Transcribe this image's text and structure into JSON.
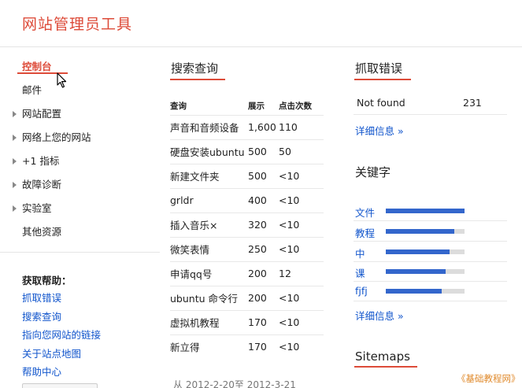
{
  "header": {
    "title": "网站管理员工具"
  },
  "nav": {
    "items": [
      {
        "label": "控制台",
        "active": true,
        "expandable": false
      },
      {
        "label": "邮件",
        "active": false,
        "expandable": false
      },
      {
        "label": "网站配置",
        "active": false,
        "expandable": true
      },
      {
        "label": "网络上您的网站",
        "active": false,
        "expandable": true
      },
      {
        "label": "+1 指标",
        "active": false,
        "expandable": true
      },
      {
        "label": "故障诊断",
        "active": false,
        "expandable": true
      },
      {
        "label": "实验室",
        "active": false,
        "expandable": true
      },
      {
        "label": "其他资源",
        "active": false,
        "expandable": false
      }
    ]
  },
  "help": {
    "title": "获取帮助：",
    "links": [
      "抓取错误",
      "搜索查询",
      "指向您网站的链接",
      "关于站点地图",
      "帮助中心"
    ]
  },
  "queries": {
    "title": "搜索查询",
    "columns": [
      "查询",
      "展示",
      "点击次数"
    ],
    "rows": [
      {
        "query": "声音和音频设备",
        "impressions": "1,600",
        "clicks": "110"
      },
      {
        "query": "硬盘安装ubuntu",
        "impressions": "500",
        "clicks": "50"
      },
      {
        "query": "新建文件夹",
        "impressions": "500",
        "clicks": "<10"
      },
      {
        "query": "grldr",
        "impressions": "400",
        "clicks": "<10"
      },
      {
        "query": "插入音乐×",
        "impressions": "320",
        "clicks": "<10"
      },
      {
        "query": "微笑表情",
        "impressions": "250",
        "clicks": "<10"
      },
      {
        "query": "申请qq号",
        "impressions": "200",
        "clicks": "12"
      },
      {
        "query": "ubuntu 命令行",
        "impressions": "200",
        "clicks": "<10"
      },
      {
        "query": "虚拟机教程",
        "impressions": "170",
        "clicks": "<10"
      },
      {
        "query": "新立得",
        "impressions": "170",
        "clicks": "<10"
      }
    ],
    "date_range": "从 2012-2-20至 2012-3-21"
  },
  "crawl_errors": {
    "title": "抓取错误",
    "rows": [
      {
        "label": "Not found",
        "count": "231"
      }
    ],
    "more": "详细信息 »"
  },
  "keywords": {
    "title": "关键字",
    "items": [
      {
        "word": "文件",
        "fraction": 1.0
      },
      {
        "word": "教程",
        "fraction": 0.87
      },
      {
        "word": "中",
        "fraction": 0.81
      },
      {
        "word": "课",
        "fraction": 0.76
      },
      {
        "word": "fjfj",
        "fraction": 0.71
      }
    ],
    "more": "详细信息 »"
  },
  "sitemaps": {
    "title": "Sitemaps"
  },
  "colors": {
    "accent": "#dd4b39",
    "link": "#1155cc",
    "bar": "#3366cc",
    "bar_track": "#dcdcdc"
  },
  "watermark": "《基础教程网》"
}
